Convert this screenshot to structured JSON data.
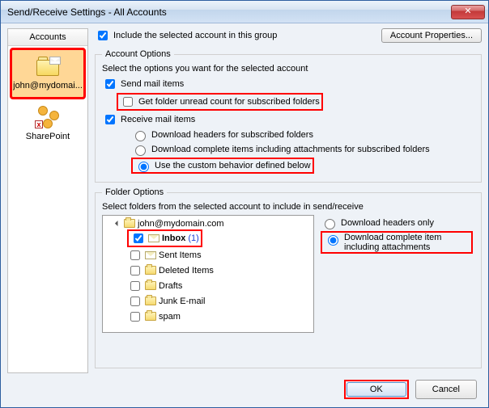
{
  "window": {
    "title": "Send/Receive Settings - All Accounts"
  },
  "sidebar": {
    "header": "Accounts",
    "items": [
      {
        "label": "john@mydomai...",
        "kind": "mail",
        "selected": true
      },
      {
        "label": "SharePoint",
        "kind": "sharepoint",
        "selected": false
      }
    ]
  },
  "toprow": {
    "include_label": "Include the selected account in this group",
    "include_checked": true,
    "properties_button": "Account Properties..."
  },
  "account_options": {
    "legend": "Account Options",
    "intro": "Select the options you want for the selected account",
    "send_label": "Send mail items",
    "send_checked": true,
    "unread_label": "Get folder unread count for subscribed folders",
    "unread_checked": false,
    "receive_label": "Receive mail items",
    "receive_checked": true,
    "radio_headers": "Download headers for subscribed folders",
    "radio_complete": "Download complete items including attachments for subscribed folders",
    "radio_custom": "Use the custom behavior defined below",
    "radio_selected": "custom"
  },
  "folder_options": {
    "legend": "Folder Options",
    "intro": "Select folders from the selected account to include in send/receive",
    "root": "john@mydomain.com",
    "folders": [
      {
        "name": "Inbox",
        "checked": true,
        "bold": true,
        "unread": 1,
        "icon": "envelope"
      },
      {
        "name": "Sent Items",
        "checked": false,
        "icon": "envelope"
      },
      {
        "name": "Deleted Items",
        "checked": false,
        "icon": "folder"
      },
      {
        "name": "Drafts",
        "checked": false,
        "icon": "folder"
      },
      {
        "name": "Junk E-mail",
        "checked": false,
        "icon": "folder"
      },
      {
        "name": "spam",
        "checked": false,
        "icon": "folder"
      }
    ],
    "right_headers": "Download headers only",
    "right_complete": "Download complete item including attachments",
    "right_selected": "complete"
  },
  "footer": {
    "ok": "OK",
    "cancel": "Cancel"
  }
}
